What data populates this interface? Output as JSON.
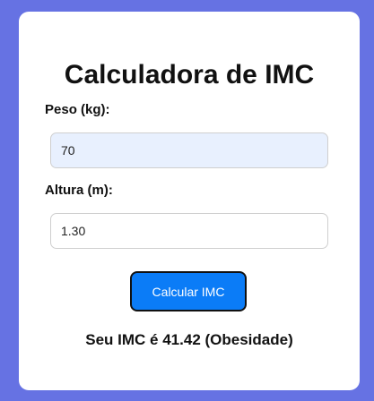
{
  "app": {
    "title": "Calculadora de IMC"
  },
  "form": {
    "peso_label": "Peso (kg):",
    "peso_value": "70",
    "altura_label": "Altura (m):",
    "altura_value": "1.30",
    "calc_button_label": "Calcular IMC"
  },
  "result": {
    "text": "Seu IMC é 41.42 (Obesidade)"
  },
  "colors": {
    "page_background": "#6672e3",
    "card_background": "#ffffff",
    "button_background": "#0b7cf7",
    "autofill_background": "#e8f0fe"
  }
}
